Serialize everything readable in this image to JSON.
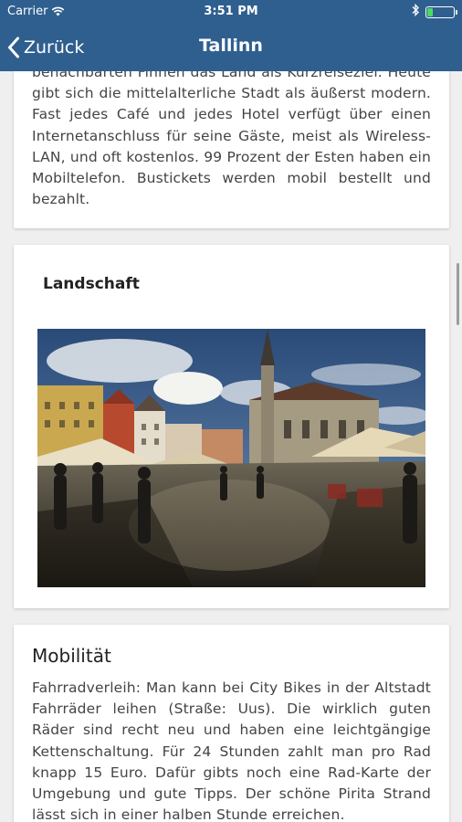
{
  "status_bar": {
    "carrier": "Carrier",
    "time": "3:51 PM",
    "battery_level": 0.2,
    "battery_color": "#4cd964"
  },
  "nav": {
    "back_label": "Zurück",
    "title": "Tallinn",
    "bar_color": "#2f5f8f"
  },
  "intro": {
    "text": "benachbarten Finnen das Land als Kurzreiseziel. Heute gibt sich die mittelalterliche Stadt als äußerst modern. Fast jedes Café und jedes Hotel verfügt über einen Internetanschluss für seine Gäste, meist als Wireless-LAN, und oft kostenlos. 99 Prozent der Esten haben ein Mobiltelefon. Bustickets werden mobil bestellt und bezahlt."
  },
  "landscape": {
    "heading": "Landschaft",
    "image_icon": "town-square-photo-icon"
  },
  "mobility": {
    "heading": "Mobilität",
    "text": "Fahrradverleih: Man kann bei City Bikes in der Altstadt Fahrräder leihen (Straße: Uus). Die wirklich guten Räder sind recht neu und haben eine leichtgängige Kettenschaltung. Für 24 Stunden zahlt man pro Rad knapp 15 Euro. Dafür gibts noch eine Rad-Karte der Umgebung und gute Tipps. Der schöne Pirita Strand lässt sich in einer halben Stunde erreichen."
  }
}
